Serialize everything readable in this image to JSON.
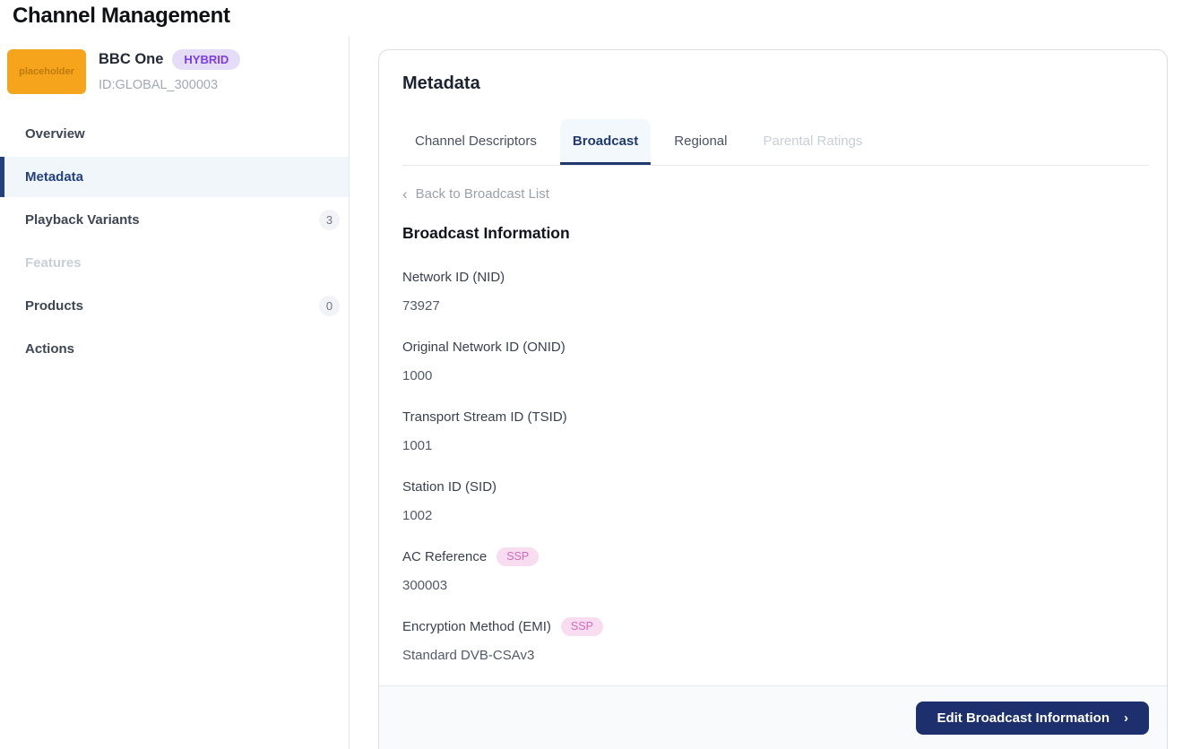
{
  "page": {
    "title": "Channel Management"
  },
  "sidebar": {
    "channel": {
      "logo_text": "placeholder",
      "name": "BBC One",
      "type_badge": "HYBRID",
      "id": "ID:GLOBAL_300003"
    },
    "items": [
      {
        "label": "Overview",
        "state": "normal"
      },
      {
        "label": "Metadata",
        "state": "active"
      },
      {
        "label": "Playback Variants",
        "state": "normal",
        "count": "3"
      },
      {
        "label": "Features",
        "state": "disabled"
      },
      {
        "label": "Products",
        "state": "normal",
        "count": "0"
      },
      {
        "label": "Actions",
        "state": "normal"
      }
    ]
  },
  "main": {
    "title": "Metadata",
    "tabs": [
      {
        "label": "Channel Descriptors",
        "state": "normal"
      },
      {
        "label": "Broadcast",
        "state": "active"
      },
      {
        "label": "Regional",
        "state": "normal"
      },
      {
        "label": "Parental Ratings",
        "state": "disabled"
      }
    ],
    "back_link": {
      "chevron": "‹",
      "label": "Back to Broadcast List"
    },
    "section_title": "Broadcast Information",
    "fields": [
      {
        "label": "Network ID (NID)",
        "value": "73927"
      },
      {
        "label": "Original Network ID (ONID)",
        "value": "1000"
      },
      {
        "label": "Transport Stream ID (TSID)",
        "value": "1001"
      },
      {
        "label": "Station ID (SID)",
        "value": "1002"
      },
      {
        "label": "AC Reference",
        "value": "300003",
        "badge": "SSP"
      },
      {
        "label": "Encryption Method (EMI)",
        "value": "Standard DVB-CSAv3",
        "badge": "SSP"
      }
    ],
    "footer": {
      "button_label": "Edit Broadcast Information",
      "button_chevron": "›"
    }
  },
  "colors": {
    "accent_navy": "#1d2f6d",
    "active_nav": "#24407e",
    "logo_orange": "#f6a41c",
    "hybrid_badge_bg": "#e5ddf8",
    "hybrid_badge_text": "#7a3ce8",
    "ssp_badge_bg": "#f8dcef",
    "ssp_badge_text": "#d26cba",
    "footer_bg": "#f8fafc"
  }
}
